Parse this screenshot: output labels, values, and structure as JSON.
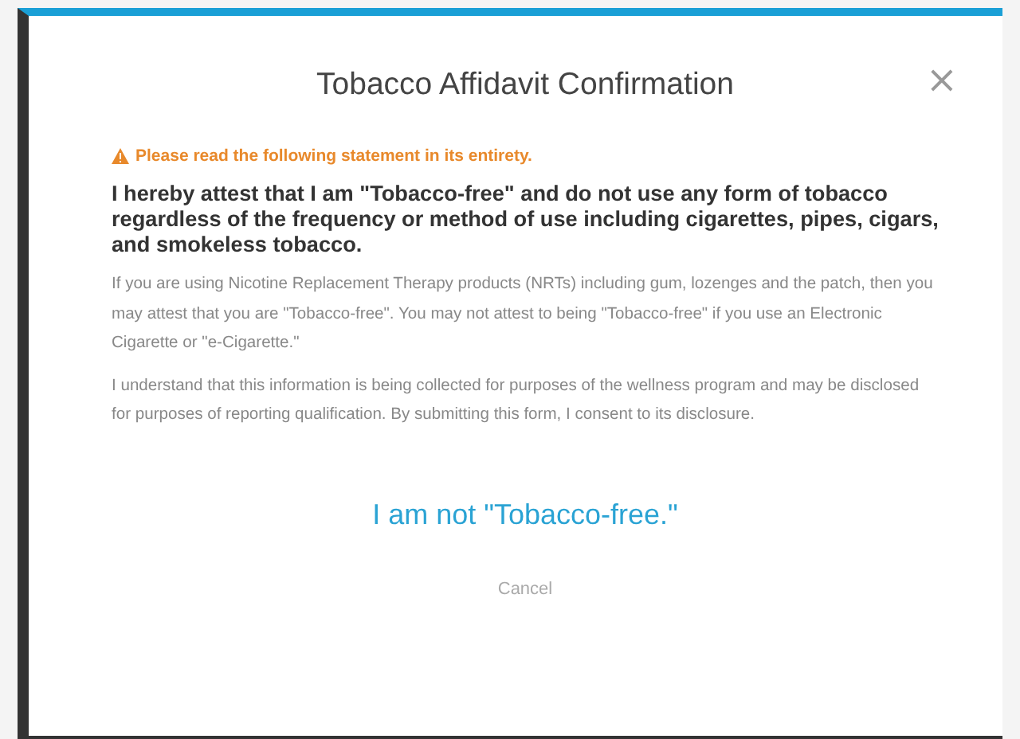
{
  "dialog": {
    "title": "Tobacco Affidavit Confirmation",
    "close": "×",
    "warning": "Please read the following statement in its entirety.",
    "statement": "I hereby attest that I am \"Tobacco-free\" and do not use any form of tobacco regardless of the frequency or method of use including cigarettes, pipes, cigars, and smokeless tobacco.",
    "paragraphs": [
      "If you are using Nicotine Replacement Therapy products (NRTs) including gum, lozenges and the patch, then you may attest that you are \"Tobacco-free\". You may not attest to being \"Tobacco-free\" if you use an Electronic Cigarette or \"e-Cigarette.\"",
      "I understand that this information is being collected for purposes of the wellness program and may be disclosed for purposes of reporting qualification. By submitting this form, I consent to its disclosure."
    ],
    "action": "I am not \"Tobacco-free.\"",
    "cancel": "Cancel"
  }
}
